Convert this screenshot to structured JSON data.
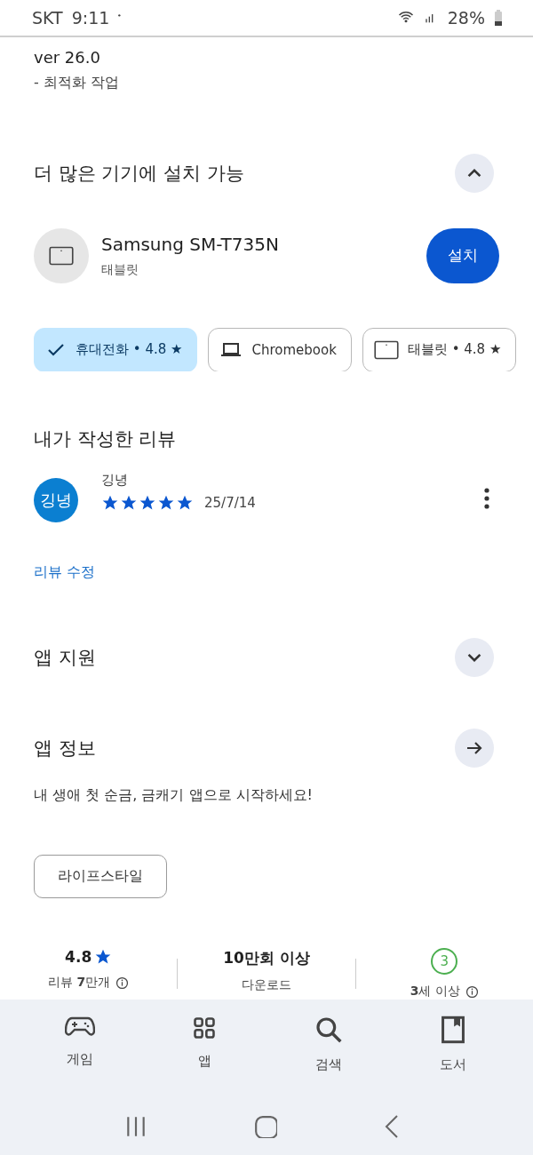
{
  "status_bar": {
    "carrier": "SKT",
    "time": "9:11",
    "battery": "28%"
  },
  "whats_new": {
    "version": "ver 26.0",
    "note": "- 최적화 작업"
  },
  "more_devices": {
    "title": "더 많은 기기에 설치 가능",
    "expanded": true,
    "device": {
      "name": "Samsung SM-T735N",
      "type": "태블릿",
      "button": "설치"
    },
    "chips": [
      {
        "label": "휴대전화 • 4.8 ★",
        "selected": true
      },
      {
        "label": "Chromebook",
        "kind": "laptop",
        "selected": false
      },
      {
        "label": "태블릿 • 4.8 ★",
        "kind": "tablet",
        "selected": false
      }
    ]
  },
  "my_review": {
    "title": "내가 작성한 리뷰",
    "avatar": "깅녕",
    "author": "깅녕",
    "stars": 5,
    "date": "25/7/14",
    "edit_link": "리뷰 수정"
  },
  "app_support": {
    "title": "앱 지원",
    "expanded": false
  },
  "app_info": {
    "title": "앱 정보",
    "description": "내 생애 첫 순금, 금캐기 앱으로 시작하세요!",
    "tag": "라이프스타일"
  },
  "stats": [
    {
      "kind": "rating",
      "value": "4.8",
      "label": "리뷰 **7**만개"
    },
    {
      "kind": "downloads",
      "value": "10만회 이상",
      "label": "다운로드"
    },
    {
      "kind": "age",
      "value": "3",
      "label": "**3**세 이상"
    }
  ],
  "bottom_nav": [
    {
      "kind": "games",
      "label": "게임"
    },
    {
      "kind": "apps",
      "label": "앱"
    },
    {
      "kind": "search",
      "label": "검색"
    },
    {
      "kind": "books",
      "label": "도서"
    }
  ]
}
